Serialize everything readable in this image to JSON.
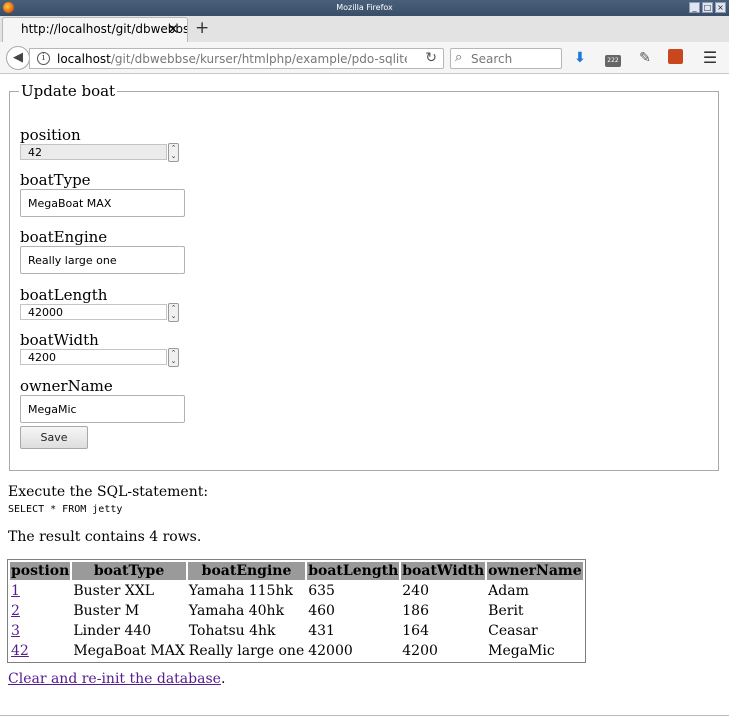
{
  "window": {
    "title": "Mozilla Firefox",
    "controls": [
      "_",
      "□",
      "×"
    ]
  },
  "tabs": [
    {
      "label": "http://localhost/git/dbwebbs"
    }
  ],
  "newtab_label": "+",
  "nav": {
    "url_host": "localhost",
    "url_path": "/git/dbwebbse/kurser/htmlphp/example/pdo-sqlite/upd",
    "url_prefix": "",
    "search_placeholder": "Search"
  },
  "form": {
    "legend": "Update boat",
    "fields": {
      "position": {
        "label": "position",
        "value": "42"
      },
      "boatType": {
        "label": "boatType",
        "value": "MegaBoat MAX"
      },
      "boatEngine": {
        "label": "boatEngine",
        "value": "Really large one"
      },
      "boatLength": {
        "label": "boatLength",
        "value": "42000"
      },
      "boatWidth": {
        "label": "boatWidth",
        "value": "4200"
      },
      "ownerName": {
        "label": "ownerName",
        "value": "MegaMic"
      }
    },
    "save_label": "Save"
  },
  "sql": {
    "execute_label": "Execute the SQL-statement:",
    "statement": "SELECT * FROM jetty",
    "result_text": "The result contains 4 rows."
  },
  "table": {
    "headers": [
      "postion",
      "boatType",
      "boatEngine",
      "boatLength",
      "boatWidth",
      "ownerName"
    ],
    "rows": [
      [
        "1",
        "Buster XXL",
        "Yamaha 115hk",
        "635",
        "240",
        "Adam"
      ],
      [
        "2",
        "Buster M",
        "Yamaha 40hk",
        "460",
        "186",
        "Berit"
      ],
      [
        "3",
        "Linder 440",
        "Tohatsu 4hk",
        "431",
        "164",
        "Ceasar"
      ],
      [
        "42",
        "MegaBoat MAX",
        "Really large one",
        "42000",
        "4200",
        "MegaMic"
      ]
    ]
  },
  "footer": {
    "clear_link": "Clear and re-init the database",
    "clear_suffix": "."
  },
  "colors": {
    "link": "#551a8b",
    "header_bg": "#9a9a9a",
    "titlebar": "#3f546f"
  }
}
